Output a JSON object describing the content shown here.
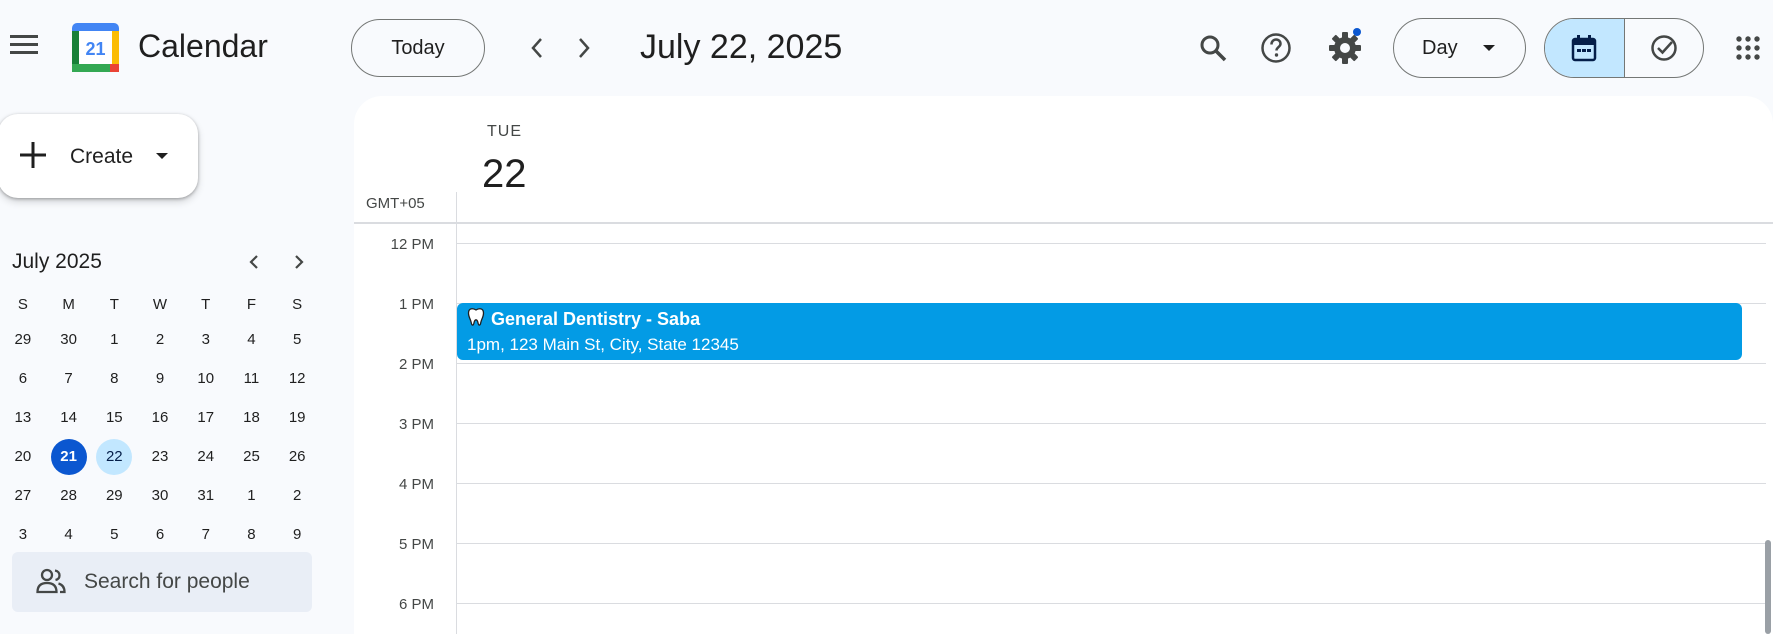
{
  "header": {
    "app_title": "Calendar",
    "logo_day": "21",
    "today_label": "Today",
    "date_title": "July 22, 2025",
    "view_label": "Day"
  },
  "sidebar": {
    "create_label": "Create",
    "mini_month_title": "July 2025",
    "weekday_heads": [
      "S",
      "M",
      "T",
      "W",
      "T",
      "F",
      "S"
    ],
    "weeks": [
      [
        "29",
        "30",
        "1",
        "2",
        "3",
        "4",
        "5"
      ],
      [
        "6",
        "7",
        "8",
        "9",
        "10",
        "11",
        "12"
      ],
      [
        "13",
        "14",
        "15",
        "16",
        "17",
        "18",
        "19"
      ],
      [
        "20",
        "21",
        "22",
        "23",
        "24",
        "25",
        "26"
      ],
      [
        "27",
        "28",
        "29",
        "30",
        "31",
        "1",
        "2"
      ],
      [
        "3",
        "4",
        "5",
        "6",
        "7",
        "8",
        "9"
      ]
    ],
    "today_date": "21",
    "selected_date": "22",
    "people_search_placeholder": "Search for people"
  },
  "main": {
    "day_name": "TUE",
    "day_number": "22",
    "timezone": "GMT+05",
    "hours": [
      "12 PM",
      "1 PM",
      "2 PM",
      "3 PM",
      "4 PM",
      "5 PM",
      "6 PM"
    ],
    "event": {
      "title": "General Dentistry - Saba",
      "details": "1pm, 123 Main St, City, State 12345",
      "color": "#039be5"
    }
  },
  "colors": {
    "accent": "#0b57d0",
    "selected_bg": "#c2e7ff",
    "event": "#039be5"
  }
}
